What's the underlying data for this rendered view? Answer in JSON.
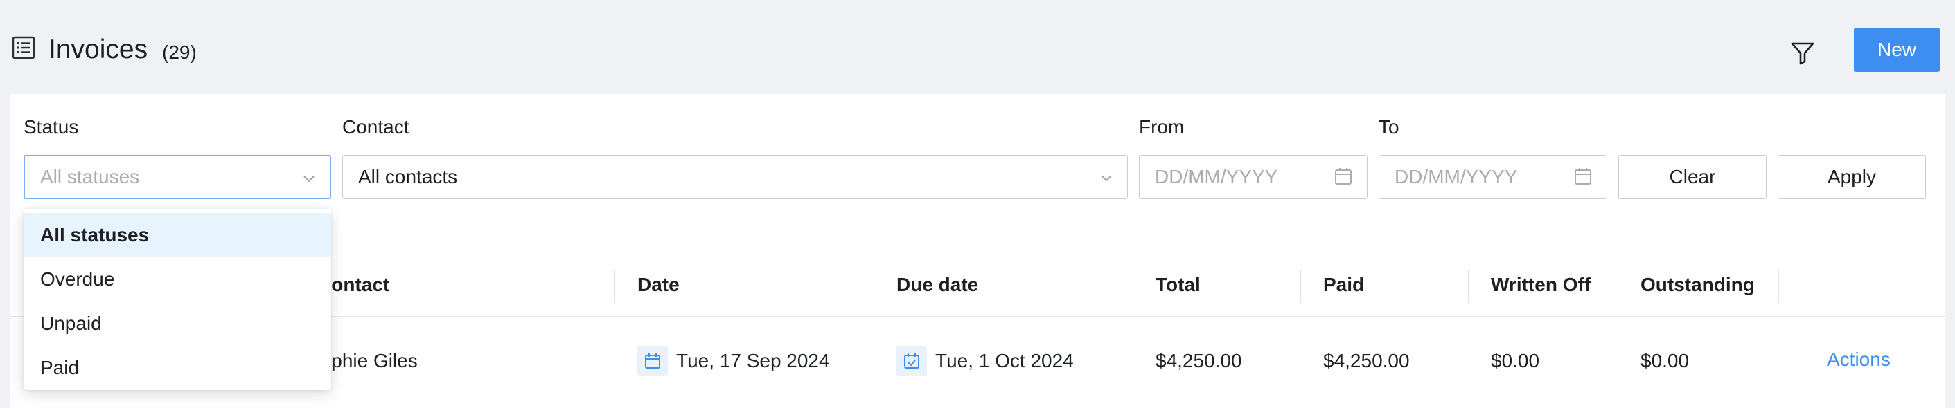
{
  "header": {
    "title": "Invoices",
    "count": "(29)",
    "new_label": "New"
  },
  "filters": {
    "status": {
      "label": "Status",
      "placeholder": "All statuses"
    },
    "contact": {
      "label": "Contact",
      "value": "All contacts"
    },
    "from": {
      "label": "From",
      "placeholder": "DD/MM/YYYY"
    },
    "to": {
      "label": "To",
      "placeholder": "DD/MM/YYYY"
    },
    "clear_label": "Clear",
    "apply_label": "Apply"
  },
  "status_dropdown": {
    "options": [
      "All statuses",
      "Overdue",
      "Unpaid",
      "Paid"
    ],
    "selected": "All statuses"
  },
  "table": {
    "columns": {
      "contact": "Contact",
      "date": "Date",
      "due_date": "Due date",
      "total": "Total",
      "paid": "Paid",
      "written_off": "Written Off",
      "outstanding": "Outstanding"
    },
    "rows": [
      {
        "contact": "Sophie Giles",
        "date": "Tue, 17 Sep 2024",
        "due_date": "Tue, 1 Oct 2024",
        "total": "$4,250.00",
        "paid": "$4,250.00",
        "written_off": "$0.00",
        "outstanding": "$0.00",
        "actions": "Actions"
      }
    ]
  },
  "colors": {
    "accent": "#3d8ef0",
    "page_bg": "#f0f1f4",
    "selected_option_bg": "#e8f4fd",
    "focus_border": "#79aef0"
  },
  "icons": {
    "title": "list-icon",
    "filter": "filter-funnel-icon",
    "select": "chevron-down-icon",
    "date_picker": "calendar-icon",
    "row_date": "calendar-icon",
    "row_due_date": "calendar-check-icon"
  }
}
